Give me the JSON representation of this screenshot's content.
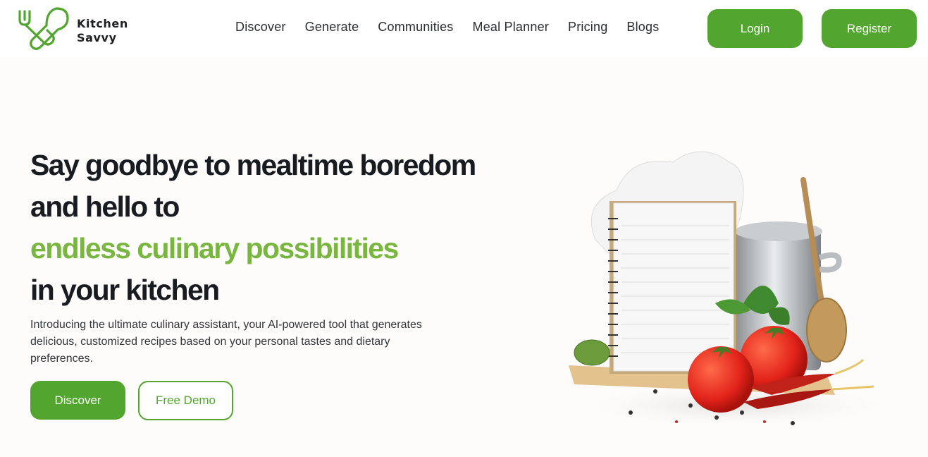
{
  "brand": {
    "line1": "Kitchen",
    "line2": "Savvy"
  },
  "nav": [
    {
      "label": "Discover"
    },
    {
      "label": "Generate"
    },
    {
      "label": "Communities"
    },
    {
      "label": "Meal Planner"
    },
    {
      "label": "Pricing"
    },
    {
      "label": "Blogs"
    }
  ],
  "auth": {
    "login": "Login",
    "register": "Register"
  },
  "hero": {
    "line1": "Say goodbye to mealtime boredom",
    "line2": "and hello to",
    "line3": "endless culinary possibilities",
    "line4": "in your kitchen",
    "description": "Introducing the ultimate culinary assistant, your AI-powered tool that generates delicious, customized recipes based on your personal tastes and dietary preferences.",
    "primary_cta": "Discover",
    "secondary_cta": "Free Demo",
    "image_icon": "chef-hat-notebook-pot-tomatoes"
  },
  "colors": {
    "brand_green": "#52a52e",
    "accent_green": "#79b640",
    "text_dark": "#181b20"
  }
}
